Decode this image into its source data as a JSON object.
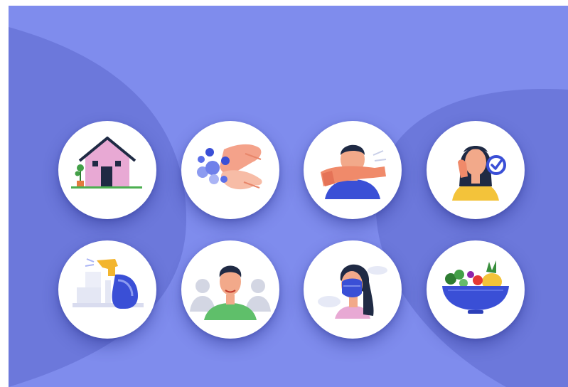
{
  "colors": {
    "background": "#7f8ced",
    "background_dark": "#6672d4",
    "tile": "#ffffff",
    "accent_blue": "#3a4fd6",
    "skin": "#f2a98a",
    "hair": "#1f2a44"
  },
  "illustrations": [
    {
      "id": "stay-home",
      "icon": "house-icon"
    },
    {
      "id": "wash-hands",
      "icon": "hand-washing-icon"
    },
    {
      "id": "cough-into-elbow",
      "icon": "cough-elbow-icon"
    },
    {
      "id": "avoid-touching-face",
      "icon": "no-face-touch-icon"
    },
    {
      "id": "disinfect-surfaces",
      "icon": "spray-bottle-icon"
    },
    {
      "id": "social-distancing",
      "icon": "distancing-icon"
    },
    {
      "id": "wear-mask",
      "icon": "face-mask-icon"
    },
    {
      "id": "healthy-diet",
      "icon": "food-bowl-icon"
    }
  ]
}
